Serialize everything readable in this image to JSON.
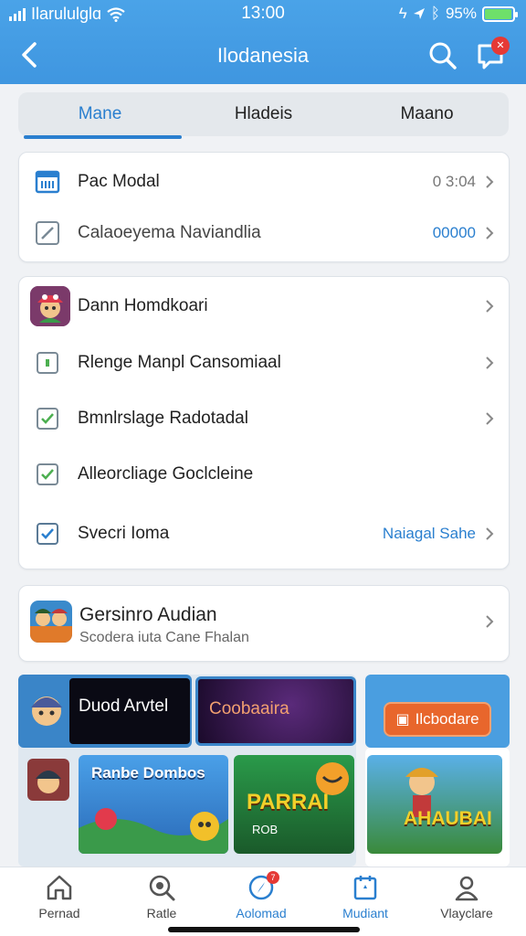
{
  "status": {
    "carrier": "Ilarululglɑ",
    "time": "13:00",
    "battery": "95%",
    "battery_level": 0.95
  },
  "header": {
    "title": "Ilodanesia",
    "message_badge": "✕"
  },
  "tabs": [
    {
      "label": "Mane"
    },
    {
      "label": "Hladeis"
    },
    {
      "label": "Maano"
    }
  ],
  "card1": {
    "rows": [
      {
        "label": "Pac Modal",
        "value": "0 3:04",
        "icon": "calendar-icon"
      },
      {
        "label": "Calaoeyema Naviandlia",
        "value": "00000",
        "icon": "edit-icon"
      }
    ]
  },
  "card2": {
    "rows": [
      {
        "label": "Dann Homdkoari",
        "value": "",
        "icon": "avatar-icon"
      },
      {
        "label": "Rlenge Manpl Cansomiaal",
        "value": "",
        "icon": "checkbox-empty-icon"
      },
      {
        "label": "Bmnlrslage Radotadal",
        "value": "",
        "icon": "checkbox-checked-icon"
      },
      {
        "label": "Alleorcliage Goclcleine",
        "value": "",
        "icon": "checkbox-checked-icon"
      },
      {
        "label": "Svecri Ioma",
        "value": "Naiagal Sahe",
        "icon": "checkbox-checked-icon"
      }
    ]
  },
  "card3": {
    "title": "Gersinro Audian",
    "subtitle": "Scodera iuta Cane Fhalan"
  },
  "games": {
    "tile1": "Duod Arvtel",
    "tile2": "Coobaaira",
    "promo_button": "Ilcbodare",
    "tile4": "Ranbe Dombos",
    "tile5": "PARRAI",
    "tile5_sub": "ROB",
    "tile6": "AHAUBAI"
  },
  "bottom_nav": [
    {
      "label": "Pernad"
    },
    {
      "label": "Ratle"
    },
    {
      "label": "Aolomad",
      "badge": "7"
    },
    {
      "label": "Mudiant"
    },
    {
      "label": "Vlayclare"
    }
  ],
  "colors": {
    "header": "#3f96e0",
    "accent": "#2a7fcf",
    "badge": "#e53935",
    "promo": "#e8662c"
  }
}
